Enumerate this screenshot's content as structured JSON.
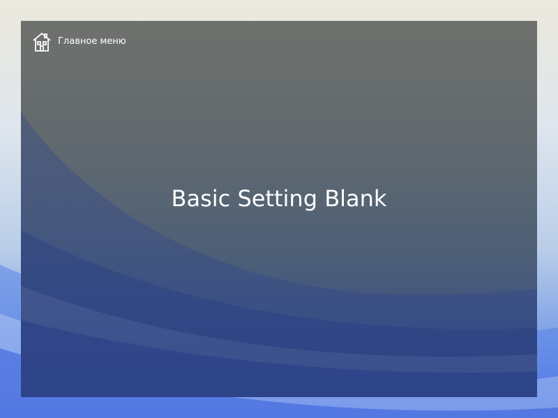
{
  "navigation": {
    "home_label": "Главное меню",
    "home_icon": "house-icon"
  },
  "main": {
    "title": "Basic Setting Blank"
  },
  "colors": {
    "panel_top": "#6f716d",
    "panel_bottom": "#334a7e",
    "text": "#ffffff",
    "outer_accent": "#3e68e0"
  }
}
